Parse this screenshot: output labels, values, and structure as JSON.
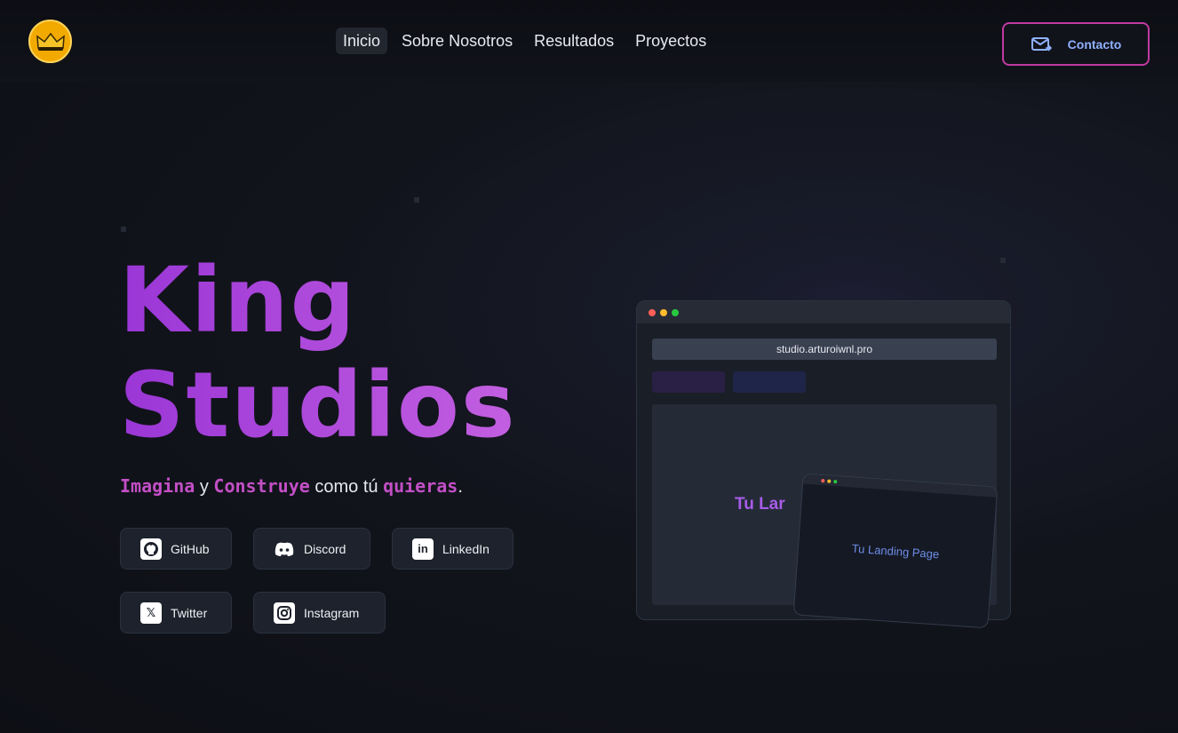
{
  "header": {
    "logo_icon": "crown-icon",
    "nav": [
      {
        "label": "Inicio",
        "active": true
      },
      {
        "label": "Sobre Nosotros",
        "active": false
      },
      {
        "label": "Resultados",
        "active": false
      },
      {
        "label": "Proyectos",
        "active": false
      }
    ],
    "contact": {
      "label": "Contacto",
      "icon": "mail-icon"
    }
  },
  "hero": {
    "title_line1": "King",
    "title_line2": "Studios",
    "tagline": {
      "w1": "Imagina",
      "s1": " y ",
      "w2": "Construye",
      "s2": " como tú ",
      "w3": "quieras",
      "s3": "."
    },
    "socials": [
      {
        "label": "GitHub",
        "icon": "github-icon"
      },
      {
        "label": "Discord",
        "icon": "discord-icon"
      },
      {
        "label": "LinkedIn",
        "icon": "linkedin-icon"
      },
      {
        "label": "Twitter",
        "icon": "x-twitter-icon"
      },
      {
        "label": "Instagram",
        "icon": "instagram-icon"
      }
    ]
  },
  "mockup": {
    "url": "studio.arturoiwnl.pro",
    "content_text": "Tu Lar",
    "tilted_text": "Tu Landing Page"
  },
  "colors": {
    "accent_purple": "#a63fd8",
    "accent_pink": "#c34fc6",
    "contact_border": "#c03aa2",
    "contact_text": "#8fb0ff",
    "background": "#12141c"
  }
}
